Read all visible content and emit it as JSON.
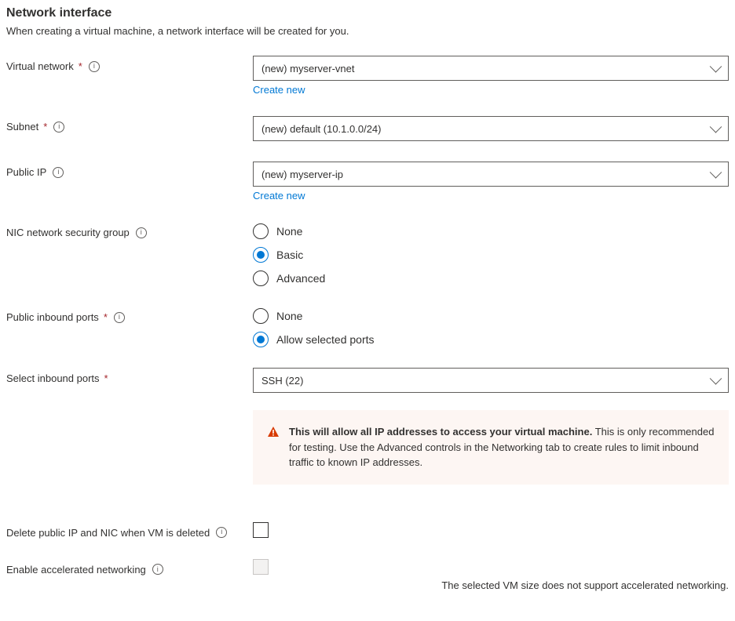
{
  "section": {
    "title": "Network interface",
    "description": "When creating a virtual machine, a network interface will be created for you."
  },
  "virtualNetwork": {
    "label": "Virtual network",
    "value": "(new) myserver-vnet",
    "createNew": "Create new"
  },
  "subnet": {
    "label": "Subnet",
    "value": "(new) default (10.1.0.0/24)"
  },
  "publicIp": {
    "label": "Public IP",
    "value": "(new) myserver-ip",
    "createNew": "Create new"
  },
  "nsg": {
    "label": "NIC network security group",
    "options": {
      "none": "None",
      "basic": "Basic",
      "advanced": "Advanced"
    }
  },
  "inboundPorts": {
    "label": "Public inbound ports",
    "options": {
      "none": "None",
      "allow": "Allow selected ports"
    }
  },
  "selectPorts": {
    "label": "Select inbound ports",
    "value": "SSH (22)"
  },
  "warning": {
    "bold": "This will allow all IP addresses to access your virtual machine.",
    "rest": "  This is only recommended for testing.  Use the Advanced controls in the Networking tab to create rules to limit inbound traffic to known IP addresses."
  },
  "deleteOnVm": {
    "label": "Delete public IP and NIC when VM is deleted"
  },
  "accelNetworking": {
    "label": "Enable accelerated networking",
    "helper": "The selected VM size does not support accelerated networking."
  }
}
